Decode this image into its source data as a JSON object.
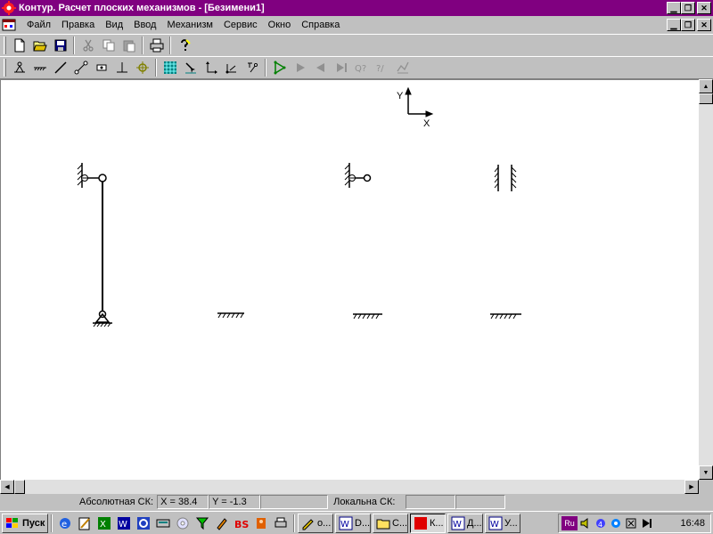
{
  "window": {
    "title": "Контур. Расчет плоских механизмов - [Безимени1]"
  },
  "menu": {
    "items": [
      {
        "label": "Файл",
        "name": "file"
      },
      {
        "label": "Правка",
        "name": "edit"
      },
      {
        "label": "Вид",
        "name": "view"
      },
      {
        "label": "Ввод",
        "name": "input"
      },
      {
        "label": "Механизм",
        "name": "mechanism"
      },
      {
        "label": "Сервис",
        "name": "service"
      },
      {
        "label": "Окно",
        "name": "window"
      },
      {
        "label": "Справка",
        "name": "help"
      }
    ]
  },
  "toolbar1": {
    "icons": [
      "new-file-icon",
      "open-folder-icon",
      "save-icon",
      "cut-icon",
      "copy-icon",
      "paste-icon",
      "print-icon",
      "help-icon"
    ]
  },
  "toolbar2": {
    "icons": [
      "link-tool-icon",
      "ground-tool-icon",
      "bar-tool-icon",
      "two-joint-bar-icon",
      "slider-tool-icon",
      "perpendicular-tool-icon",
      "target-point-icon",
      "grid-toggle-icon",
      "snap-icon",
      "axes-icon",
      "local-axes-icon",
      "measure-icon",
      "run-icon",
      "play-icon",
      "step-back-icon",
      "step-forward-icon",
      "query-icon",
      "query-help-icon",
      "graph-icon"
    ]
  },
  "canvas": {
    "axes": {
      "y_label": "Y",
      "x_label": "X"
    }
  },
  "statusbar": {
    "abs_label": "Абсолютная СК:",
    "x_value": "X = 38.4",
    "y_value": "Y = -1.3",
    "local_label": "Локальна СК:"
  },
  "taskbar": {
    "start_label": "Пуск",
    "tasks": [
      {
        "label": "о...",
        "name": "task-o",
        "icon": "pencil-icon",
        "active": false
      },
      {
        "label": "D...",
        "name": "task-d",
        "icon": "word-icon",
        "active": false
      },
      {
        "label": "С...",
        "name": "task-s",
        "icon": "folder-icon",
        "active": false
      },
      {
        "label": "К...",
        "name": "task-k",
        "icon": "kontur-icon",
        "active": true
      },
      {
        "label": "Д...",
        "name": "task-d2",
        "icon": "word-icon",
        "active": false
      },
      {
        "label": "У...",
        "name": "task-u",
        "icon": "word-icon",
        "active": false
      }
    ],
    "tray": {
      "lang": "Ru",
      "clock": "16:48"
    }
  },
  "colors": {
    "titlebar": "#800080",
    "face": "#c0c0c0",
    "canvas": "#ffffff",
    "kontur_red": "#e00000"
  }
}
